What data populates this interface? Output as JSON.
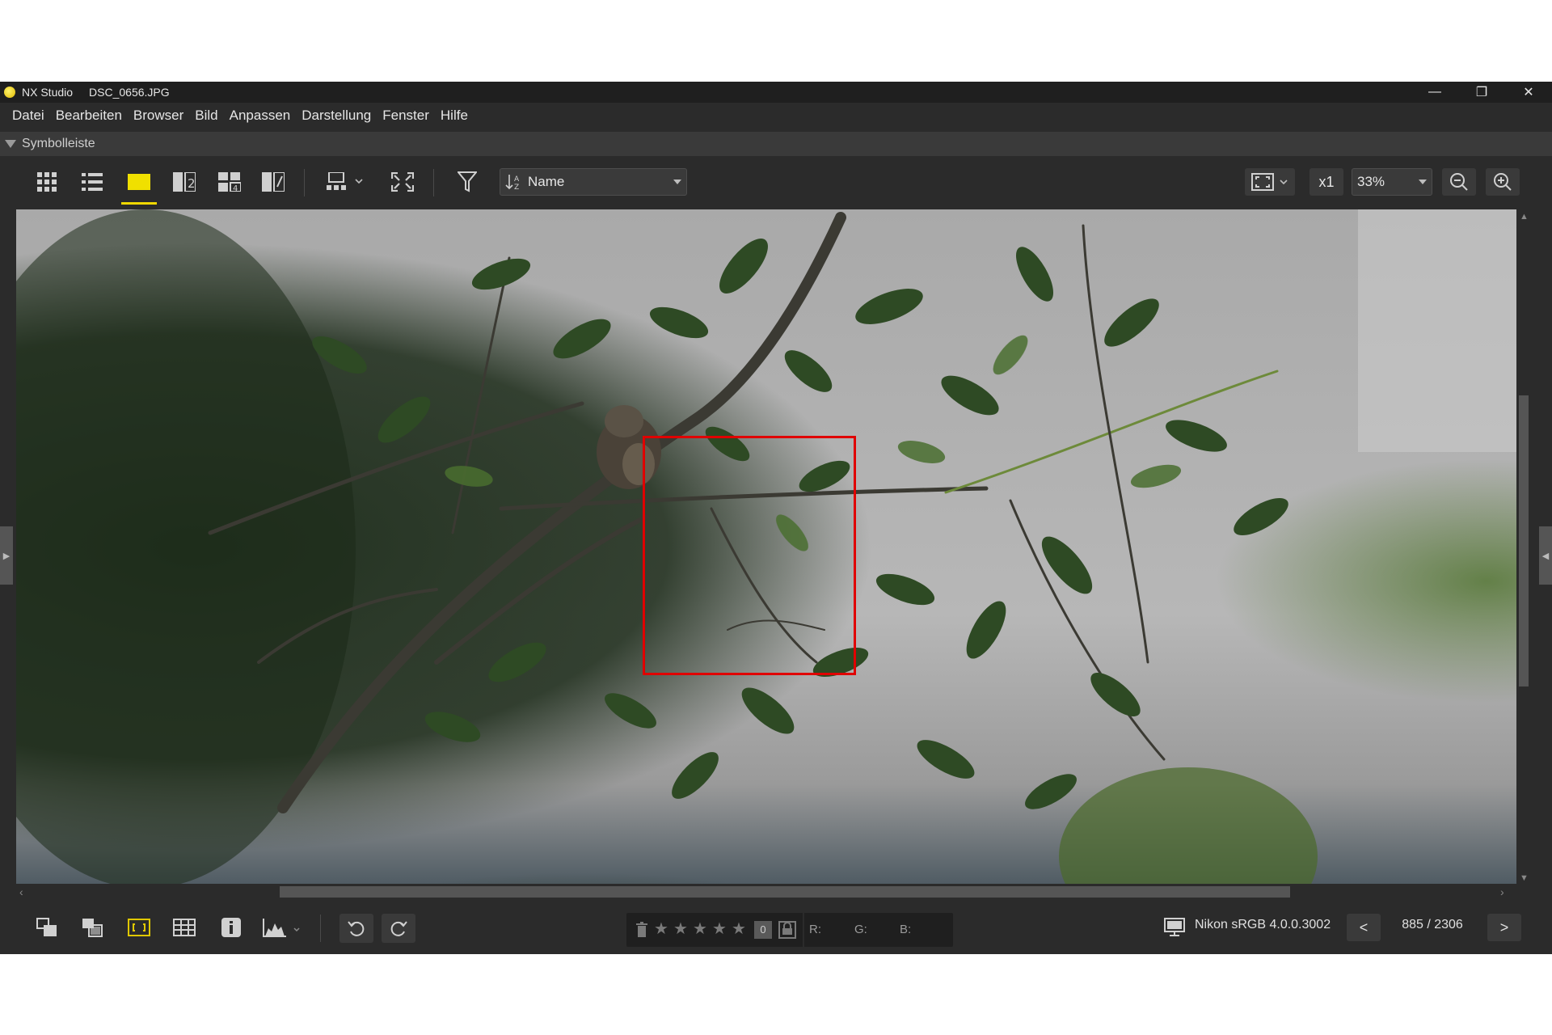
{
  "window": {
    "app_name": "NX Studio",
    "file_name": "DSC_0656.JPG",
    "controls": {
      "minimize": "—",
      "restore": "❐",
      "close": "✕"
    }
  },
  "menu": [
    "Datei",
    "Bearbeiten",
    "Browser",
    "Bild",
    "Anpassen",
    "Darstellung",
    "Fenster",
    "Hilfe"
  ],
  "toolbar_header": {
    "label": "Symbolleiste"
  },
  "toolbar": {
    "sort_by": "Name",
    "view_fit_icon": "fit-to-window-icon",
    "scale_label": "x1",
    "zoom_value": "33%",
    "active_view": "single-image-view",
    "accent_color": "#f0d800"
  },
  "viewer": {
    "focus_point_color": "#e00000"
  },
  "bottom": {
    "rating_zero": "0",
    "rgb": {
      "r_label": "R:",
      "g_label": "G:",
      "b_label": "B:"
    },
    "color_profile": "Nikon sRGB 4.0.0.3002",
    "counter": "885 / 2306",
    "prev": "<",
    "next": ">"
  }
}
